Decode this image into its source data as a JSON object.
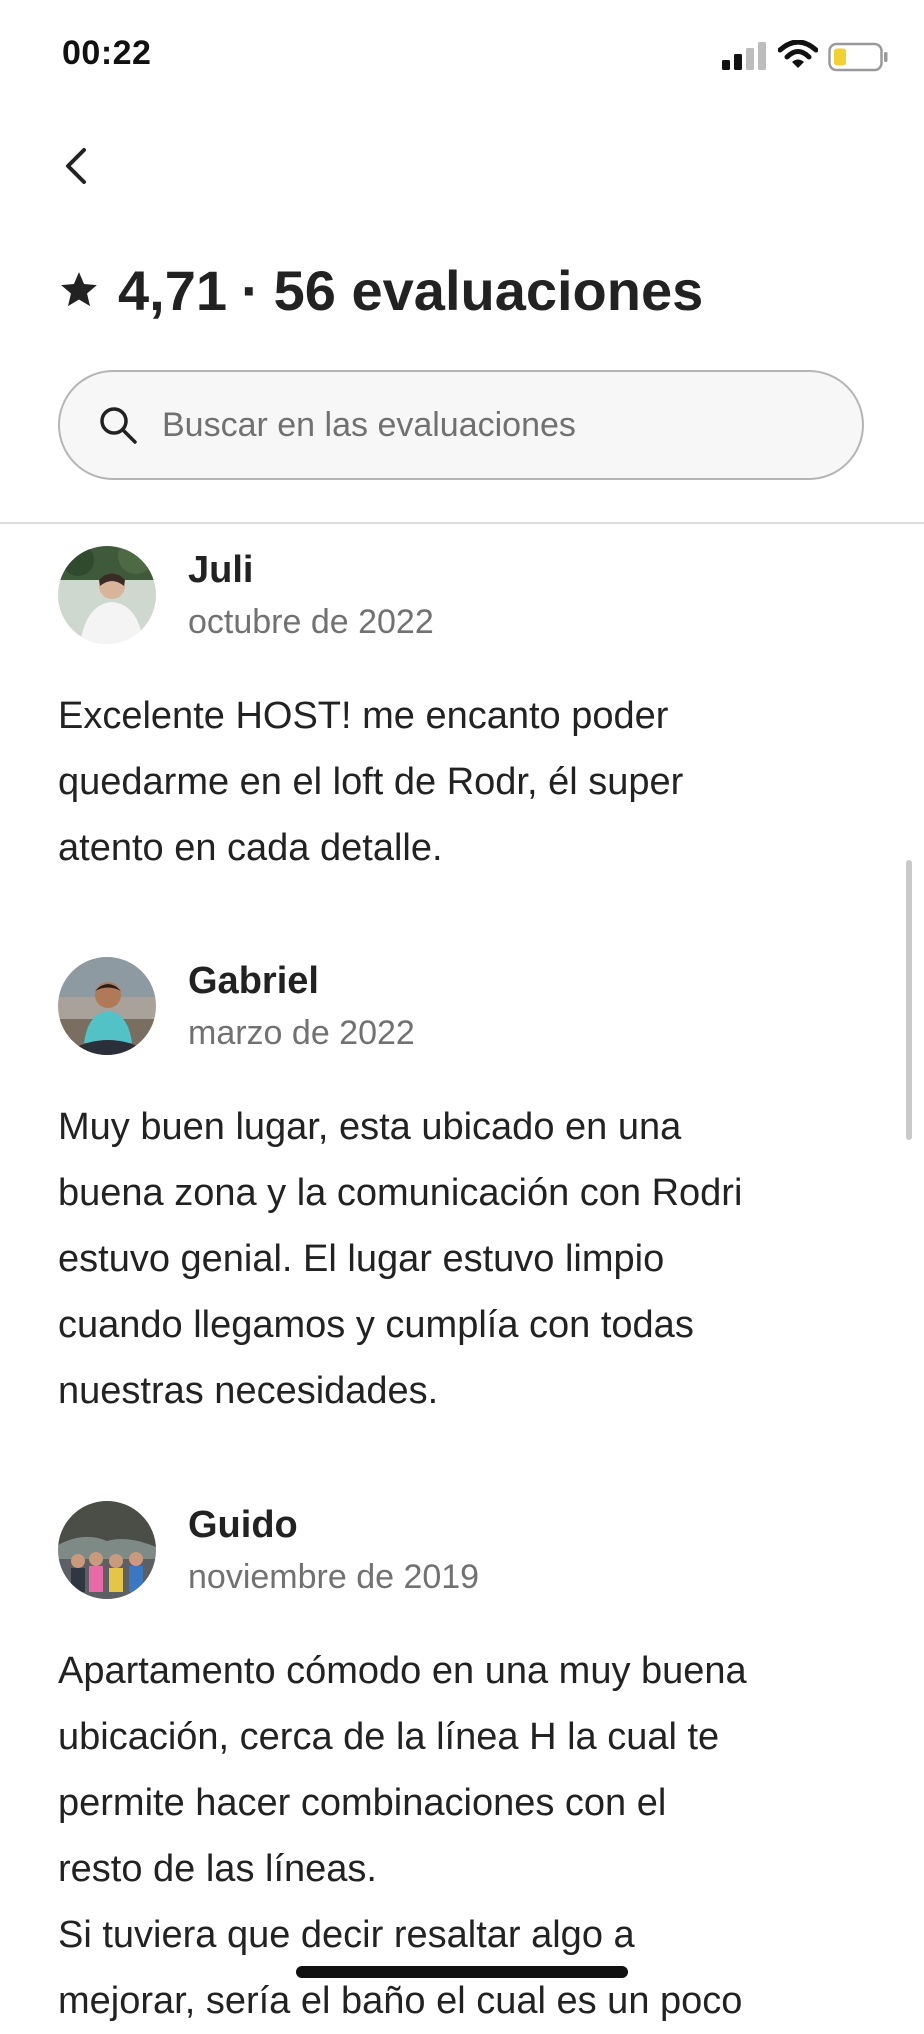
{
  "status_bar": {
    "time": "00:22",
    "icons": [
      "cellular-signal-icon",
      "wifi-icon",
      "battery-low-icon"
    ],
    "battery_color": "#f2d02f"
  },
  "nav": {
    "back_icon": "chevron-left-icon"
  },
  "header": {
    "star_icon": "star-icon",
    "rating": "4,71",
    "separator": "·",
    "reviews_count": "56 evaluaciones"
  },
  "search": {
    "icon": "search-icon",
    "placeholder": "Buscar en las evaluaciones",
    "value": ""
  },
  "reviews": [
    {
      "name": "Juli",
      "date": "octubre de 2022",
      "text_lines": [
        "Excelente HOST! me encanto poder",
        "quedarme en el loft de Rodr, él super",
        "atento en cada detalle."
      ]
    },
    {
      "name": "Gabriel",
      "date": "marzo de 2022",
      "text_lines": [
        "Muy buen lugar, esta ubicado en una",
        "buena zona y la comunicación con Rodri",
        "estuvo genial. El lugar estuvo limpio",
        "cuando llegamos y cumplía con todas",
        "nuestras necesidades."
      ]
    },
    {
      "name": "Guido",
      "date": "noviembre de 2019",
      "text_lines": [
        "Apartamento cómodo en una muy buena",
        "ubicación, cerca de la línea H la cual  te",
        "permite hacer combinaciones con el",
        "resto de las líneas.",
        "Si tuviera que decir resaltar algo a",
        "mejorar, sería el baño el cual es un poco"
      ]
    }
  ],
  "colors": {
    "text_primary": "#222222",
    "text_secondary": "#717171",
    "search_border": "#b5b5b5",
    "search_bg": "#f7f7f7"
  }
}
